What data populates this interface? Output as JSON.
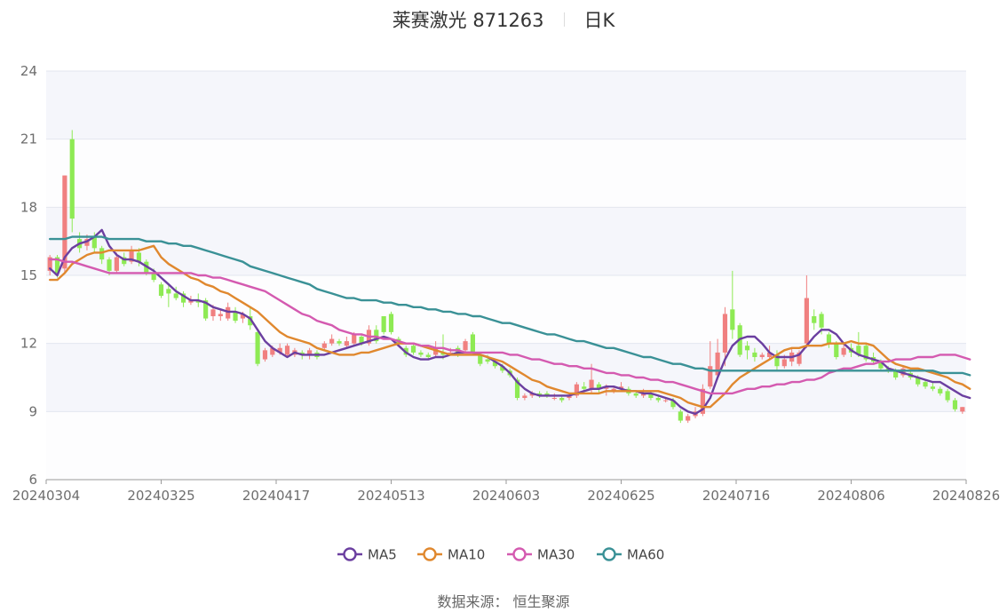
{
  "header": {
    "title": "莱赛激光 871263",
    "period": "日K"
  },
  "footer": {
    "source": "数据来源： 恒生聚源"
  },
  "colors": {
    "up": "#f08080",
    "down": "#8eea54",
    "MA5": "#6b3fa0",
    "MA10": "#e0882e",
    "MA30": "#d45ab0",
    "MA60": "#3a9196",
    "band": "#f5f6fb",
    "grid": "#e3e6ef",
    "axis": "#9a9a9a"
  },
  "chart_data": {
    "type": "candlestick",
    "title": "莱赛激光 871263",
    "ylim": [
      6,
      24
    ],
    "yticks": [
      6,
      9,
      12,
      15,
      18,
      21,
      24
    ],
    "xticks": [
      "20240304",
      "20240325",
      "20240417",
      "20240513",
      "20240603",
      "20240625",
      "20240716",
      "20240806",
      "20240826"
    ],
    "legend": [
      "MA5",
      "MA10",
      "MA30",
      "MA60"
    ],
    "legend_position": "bottom",
    "candles": [
      [
        15.2,
        15.8,
        15.9,
        15.0
      ],
      [
        15.8,
        15.1,
        15.9,
        14.9
      ],
      [
        15.3,
        19.4,
        19.4,
        15.1
      ],
      [
        21.0,
        17.5,
        21.4,
        16.9
      ],
      [
        16.6,
        16.2,
        16.9,
        16.0
      ],
      [
        16.3,
        16.6,
        16.8,
        16.1
      ],
      [
        16.7,
        16.2,
        16.9,
        16.0
      ],
      [
        16.2,
        15.7,
        16.3,
        15.5
      ],
      [
        15.7,
        15.2,
        15.8,
        15.0
      ],
      [
        15.2,
        15.8,
        16.0,
        15.1
      ],
      [
        15.8,
        15.5,
        16.0,
        15.4
      ],
      [
        15.6,
        16.1,
        16.3,
        15.5
      ],
      [
        16.0,
        15.6,
        16.2,
        15.4
      ],
      [
        15.6,
        15.1,
        15.7,
        15.0
      ],
      [
        15.1,
        14.8,
        15.3,
        14.7
      ],
      [
        14.6,
        14.1,
        14.7,
        14.0
      ],
      [
        14.4,
        14.2,
        14.6,
        13.6
      ],
      [
        14.2,
        14.0,
        14.5,
        13.9
      ],
      [
        14.2,
        13.8,
        14.3,
        13.6
      ],
      [
        13.8,
        13.9,
        14.1,
        13.7
      ],
      [
        13.9,
        13.8,
        14.2,
        13.6
      ],
      [
        13.9,
        13.1,
        14.0,
        13.0
      ],
      [
        13.2,
        13.5,
        13.7,
        13.0
      ],
      [
        13.2,
        13.3,
        13.5,
        13.0
      ],
      [
        13.1,
        13.6,
        13.8,
        13.0
      ],
      [
        13.4,
        13.0,
        13.6,
        12.9
      ],
      [
        13.1,
        13.3,
        13.4,
        12.9
      ],
      [
        13.2,
        12.8,
        13.6,
        12.6
      ],
      [
        12.5,
        11.1,
        12.6,
        11.0
      ],
      [
        11.3,
        11.7,
        11.8,
        11.2
      ],
      [
        11.5,
        11.8,
        11.9,
        11.4
      ],
      [
        11.6,
        11.8,
        12.0,
        11.5
      ],
      [
        11.5,
        11.9,
        12.0,
        11.4
      ],
      [
        11.5,
        11.7,
        11.8,
        11.4
      ],
      [
        11.6,
        11.5,
        11.7,
        11.3
      ],
      [
        11.5,
        11.7,
        11.8,
        11.3
      ],
      [
        11.6,
        11.4,
        11.7,
        11.3
      ],
      [
        11.8,
        12.0,
        12.1,
        11.7
      ],
      [
        12.0,
        12.2,
        12.4,
        11.9
      ],
      [
        12.1,
        12.0,
        12.2,
        11.9
      ],
      [
        11.9,
        12.1,
        12.3,
        11.8
      ],
      [
        12.0,
        12.4,
        12.5,
        11.9
      ],
      [
        12.3,
        12.0,
        12.4,
        11.9
      ],
      [
        12.0,
        12.6,
        12.8,
        11.9
      ],
      [
        12.6,
        12.1,
        12.8,
        12.0
      ],
      [
        13.2,
        12.5,
        13.2,
        12.4
      ],
      [
        13.3,
        12.5,
        13.4,
        12.4
      ],
      [
        12.2,
        12.0,
        12.3,
        11.9
      ],
      [
        11.8,
        11.5,
        11.9,
        11.4
      ],
      [
        11.9,
        11.6,
        12.0,
        11.5
      ],
      [
        11.6,
        11.5,
        11.7,
        11.4
      ],
      [
        11.5,
        11.4,
        11.6,
        11.3
      ],
      [
        11.5,
        11.8,
        12.1,
        11.4
      ],
      [
        11.6,
        11.5,
        12.4,
        11.3
      ],
      [
        11.6,
        11.6,
        11.8,
        11.5
      ],
      [
        11.8,
        11.5,
        11.9,
        11.4
      ],
      [
        11.7,
        12.1,
        12.2,
        11.6
      ],
      [
        12.4,
        11.6,
        12.5,
        11.5
      ],
      [
        11.5,
        11.1,
        11.6,
        11.0
      ],
      [
        11.3,
        11.2,
        11.5,
        11.1
      ],
      [
        11.2,
        11.0,
        11.3,
        10.9
      ],
      [
        11.0,
        10.8,
        11.1,
        10.7
      ],
      [
        10.8,
        10.6,
        10.9,
        10.5
      ],
      [
        10.4,
        9.6,
        10.5,
        9.5
      ],
      [
        9.6,
        9.7,
        9.8,
        9.5
      ],
      [
        9.7,
        9.8,
        9.9,
        9.6
      ],
      [
        9.8,
        9.7,
        9.9,
        9.6
      ],
      [
        9.8,
        9.7,
        9.9,
        9.6
      ],
      [
        9.6,
        9.6,
        9.8,
        9.5
      ],
      [
        9.6,
        9.5,
        9.7,
        9.4
      ],
      [
        9.6,
        9.7,
        9.8,
        9.5
      ],
      [
        9.7,
        10.2,
        10.3,
        9.6
      ],
      [
        10.1,
        10.0,
        10.3,
        9.9
      ],
      [
        10.0,
        10.4,
        11.1,
        9.8
      ],
      [
        10.2,
        10.0,
        10.3,
        9.8
      ],
      [
        10.0,
        10.1,
        10.2,
        9.7
      ],
      [
        9.9,
        10.0,
        10.1,
        9.8
      ],
      [
        10.0,
        10.1,
        10.3,
        9.9
      ],
      [
        10.0,
        9.8,
        10.1,
        9.7
      ],
      [
        9.8,
        9.7,
        9.9,
        9.6
      ],
      [
        9.7,
        9.8,
        10.0,
        9.6
      ],
      [
        9.8,
        9.6,
        9.9,
        9.5
      ],
      [
        9.6,
        9.5,
        9.7,
        9.4
      ],
      [
        9.5,
        9.5,
        9.6,
        9.4
      ],
      [
        9.5,
        9.2,
        9.6,
        9.1
      ],
      [
        9.0,
        8.6,
        9.1,
        8.5
      ],
      [
        8.6,
        8.8,
        8.9,
        8.5
      ],
      [
        8.8,
        9.0,
        9.2,
        8.7
      ],
      [
        8.9,
        10.0,
        10.2,
        8.8
      ],
      [
        10.1,
        11.0,
        12.1,
        10.0
      ],
      [
        10.6,
        11.6,
        12.2,
        10.4
      ],
      [
        11.6,
        13.3,
        13.6,
        11.0
      ],
      [
        13.5,
        12.6,
        15.2,
        12.2
      ],
      [
        12.8,
        11.5,
        12.9,
        11.4
      ],
      [
        11.9,
        11.7,
        12.1,
        11.3
      ],
      [
        11.6,
        11.4,
        11.8,
        11.2
      ],
      [
        11.4,
        11.5,
        11.6,
        11.3
      ],
      [
        11.4,
        11.6,
        11.9,
        11.3
      ],
      [
        11.5,
        11.0,
        11.7,
        10.8
      ],
      [
        11.0,
        11.3,
        11.5,
        10.9
      ],
      [
        11.2,
        11.6,
        11.8,
        11.0
      ],
      [
        11.1,
        11.6,
        11.7,
        11.0
      ],
      [
        12.0,
        14.0,
        15.0,
        11.8
      ],
      [
        13.2,
        12.9,
        13.5,
        12.6
      ],
      [
        13.3,
        12.7,
        13.4,
        12.4
      ],
      [
        12.4,
        12.0,
        12.5,
        11.8
      ],
      [
        12.0,
        11.4,
        12.1,
        11.3
      ],
      [
        11.5,
        11.8,
        12.0,
        11.4
      ],
      [
        11.8,
        11.6,
        12.0,
        11.4
      ],
      [
        11.9,
        11.5,
        12.5,
        11.4
      ],
      [
        11.9,
        11.3,
        12.0,
        11.2
      ],
      [
        11.4,
        11.2,
        11.6,
        11.1
      ],
      [
        11.2,
        10.9,
        11.3,
        10.8
      ],
      [
        10.9,
        10.8,
        11.0,
        10.7
      ],
      [
        10.8,
        10.5,
        10.9,
        10.4
      ],
      [
        10.6,
        10.9,
        11.0,
        10.5
      ],
      [
        10.7,
        10.5,
        10.8,
        10.4
      ],
      [
        10.5,
        10.2,
        10.6,
        10.1
      ],
      [
        10.3,
        10.1,
        10.4,
        10.0
      ],
      [
        10.1,
        10.0,
        10.3,
        9.9
      ],
      [
        10.0,
        9.8,
        10.1,
        9.7
      ],
      [
        9.9,
        9.5,
        10.0,
        9.4
      ],
      [
        9.5,
        9.1,
        9.6,
        9.0
      ],
      [
        9.0,
        9.2,
        9.2,
        8.9
      ]
    ],
    "series": [
      {
        "name": "MA5",
        "values": [
          15.3,
          15.0,
          15.8,
          16.2,
          16.4,
          16.5,
          16.7,
          17.0,
          16.3,
          15.9,
          15.7,
          15.7,
          15.6,
          15.4,
          15.2,
          14.9,
          14.6,
          14.3,
          14.1,
          13.9,
          13.9,
          13.8,
          13.6,
          13.5,
          13.4,
          13.4,
          13.3,
          13.1,
          12.6,
          12.1,
          11.8,
          11.6,
          11.4,
          11.6,
          11.5,
          11.5,
          11.5,
          11.5,
          11.6,
          11.7,
          11.8,
          11.9,
          12.0,
          12.1,
          12.2,
          12.3,
          12.2,
          11.9,
          11.6,
          11.4,
          11.3,
          11.3,
          11.4,
          11.4,
          11.5,
          11.6,
          11.6,
          11.6,
          11.5,
          11.4,
          11.2,
          11.0,
          10.7,
          10.3,
          10.0,
          9.8,
          9.7,
          9.7,
          9.7,
          9.7,
          9.7,
          9.8,
          9.9,
          10.0,
          10.0,
          10.1,
          10.1,
          10.0,
          9.9,
          9.9,
          9.8,
          9.8,
          9.7,
          9.6,
          9.5,
          9.2,
          9.0,
          8.9,
          9.1,
          9.6,
          10.5,
          11.3,
          11.9,
          12.2,
          12.3,
          12.3,
          12.0,
          11.6,
          11.4,
          11.4,
          11.4,
          11.5,
          11.9,
          12.3,
          12.6,
          12.6,
          12.4,
          12.0,
          11.7,
          11.5,
          11.4,
          11.3,
          11.2,
          10.9,
          10.8,
          10.7,
          10.6,
          10.5,
          10.4,
          10.3,
          10.3,
          10.1,
          9.9,
          9.7,
          9.6
        ]
      },
      {
        "name": "MA10",
        "values": [
          14.8,
          14.8,
          15.1,
          15.5,
          15.7,
          15.9,
          16.0,
          16.0,
          16.1,
          16.1,
          16.1,
          16.1,
          16.1,
          16.2,
          16.3,
          15.8,
          15.5,
          15.3,
          15.1,
          14.9,
          14.8,
          14.6,
          14.5,
          14.3,
          14.2,
          14.0,
          13.8,
          13.6,
          13.4,
          13.1,
          12.8,
          12.5,
          12.3,
          12.2,
          12.1,
          12.0,
          11.8,
          11.7,
          11.6,
          11.5,
          11.5,
          11.5,
          11.6,
          11.6,
          11.7,
          11.8,
          11.9,
          12.0,
          12.0,
          12.0,
          11.9,
          11.8,
          11.7,
          11.6,
          11.5,
          11.5,
          11.5,
          11.5,
          11.5,
          11.4,
          11.3,
          11.2,
          11.0,
          10.8,
          10.6,
          10.4,
          10.3,
          10.1,
          10.0,
          9.9,
          9.8,
          9.8,
          9.8,
          9.8,
          9.8,
          9.9,
          9.9,
          9.9,
          9.9,
          9.9,
          9.9,
          9.9,
          9.9,
          9.8,
          9.7,
          9.6,
          9.4,
          9.3,
          9.2,
          9.2,
          9.5,
          9.8,
          10.2,
          10.5,
          10.7,
          10.9,
          11.1,
          11.3,
          11.5,
          11.7,
          11.8,
          11.8,
          11.9,
          11.9,
          11.9,
          12.0,
          12.0,
          12.0,
          12.1,
          12.0,
          12.0,
          11.9,
          11.6,
          11.3,
          11.1,
          11.0,
          10.9,
          10.9,
          10.8,
          10.7,
          10.6,
          10.5,
          10.3,
          10.2,
          10.0
        ]
      },
      {
        "name": "MA30",
        "values": [
          15.7,
          15.7,
          15.6,
          15.6,
          15.5,
          15.4,
          15.3,
          15.2,
          15.1,
          15.1,
          15.1,
          15.1,
          15.1,
          15.1,
          15.1,
          15.1,
          15.1,
          15.1,
          15.1,
          15.1,
          15.0,
          15.0,
          14.9,
          14.9,
          14.8,
          14.7,
          14.6,
          14.5,
          14.4,
          14.3,
          14.1,
          13.9,
          13.7,
          13.5,
          13.3,
          13.2,
          13.0,
          12.9,
          12.8,
          12.6,
          12.5,
          12.4,
          12.4,
          12.3,
          12.3,
          12.2,
          12.2,
          12.1,
          12.0,
          12.0,
          11.9,
          11.9,
          11.8,
          11.8,
          11.7,
          11.7,
          11.6,
          11.6,
          11.6,
          11.6,
          11.6,
          11.6,
          11.5,
          11.5,
          11.4,
          11.3,
          11.3,
          11.2,
          11.1,
          11.1,
          11.0,
          11.0,
          10.9,
          10.9,
          10.8,
          10.7,
          10.7,
          10.6,
          10.6,
          10.5,
          10.5,
          10.4,
          10.4,
          10.3,
          10.3,
          10.2,
          10.1,
          10.0,
          9.9,
          9.8,
          9.8,
          9.8,
          9.8,
          9.9,
          10.0,
          10.0,
          10.1,
          10.1,
          10.2,
          10.2,
          10.3,
          10.3,
          10.4,
          10.4,
          10.5,
          10.7,
          10.8,
          10.9,
          10.9,
          11.0,
          11.1,
          11.1,
          11.2,
          11.2,
          11.3,
          11.3,
          11.3,
          11.4,
          11.4,
          11.4,
          11.5,
          11.5,
          11.5,
          11.4,
          11.3
        ]
      },
      {
        "name": "MA60",
        "values": [
          16.6,
          16.6,
          16.6,
          16.7,
          16.7,
          16.7,
          16.7,
          16.7,
          16.6,
          16.6,
          16.6,
          16.6,
          16.6,
          16.5,
          16.5,
          16.5,
          16.4,
          16.4,
          16.3,
          16.3,
          16.2,
          16.1,
          16.0,
          15.9,
          15.8,
          15.7,
          15.6,
          15.4,
          15.3,
          15.2,
          15.1,
          15.0,
          14.9,
          14.8,
          14.7,
          14.6,
          14.4,
          14.3,
          14.2,
          14.1,
          14.0,
          14.0,
          13.9,
          13.9,
          13.9,
          13.8,
          13.8,
          13.7,
          13.7,
          13.6,
          13.6,
          13.5,
          13.5,
          13.4,
          13.4,
          13.3,
          13.3,
          13.2,
          13.2,
          13.1,
          13.0,
          12.9,
          12.9,
          12.8,
          12.7,
          12.6,
          12.5,
          12.4,
          12.4,
          12.3,
          12.2,
          12.1,
          12.1,
          12.0,
          11.9,
          11.8,
          11.8,
          11.7,
          11.6,
          11.5,
          11.4,
          11.4,
          11.3,
          11.2,
          11.1,
          11.1,
          11.0,
          10.9,
          10.9,
          10.8,
          10.8,
          10.8,
          10.8,
          10.8,
          10.8,
          10.8,
          10.8,
          10.8,
          10.8,
          10.8,
          10.8,
          10.8,
          10.8,
          10.8,
          10.8,
          10.8,
          10.8,
          10.8,
          10.8,
          10.8,
          10.8,
          10.8,
          10.8,
          10.8,
          10.8,
          10.8,
          10.8,
          10.8,
          10.8,
          10.8,
          10.7,
          10.7,
          10.7,
          10.7,
          10.6
        ]
      }
    ]
  }
}
